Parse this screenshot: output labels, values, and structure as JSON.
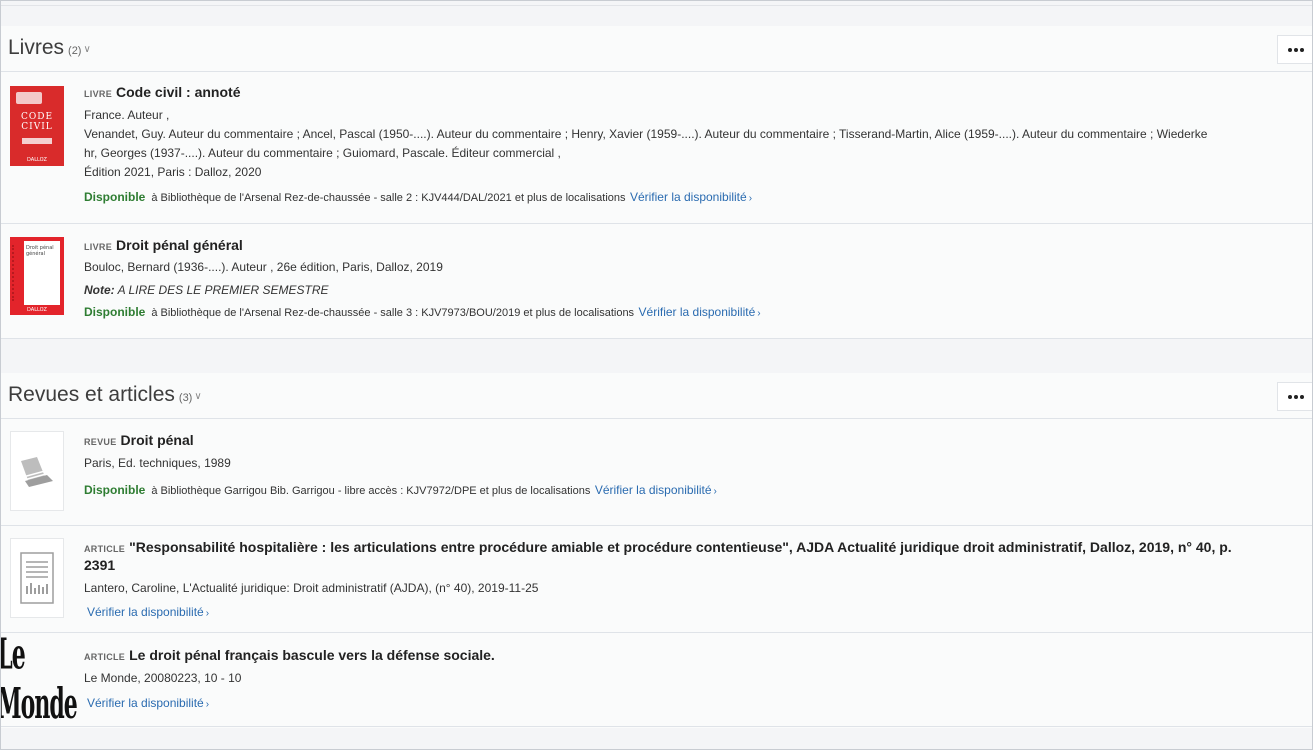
{
  "sections": [
    {
      "title": "Livres",
      "count": "(2)",
      "items": [
        {
          "type": "LIVRE",
          "title": "Code civil : annoté",
          "lines": [
            "France. Auteur ,",
            "Venandet, Guy. Auteur du commentaire ; Ancel, Pascal (1950-....). Auteur du commentaire ; Henry, Xavier (1959-....). Auteur du commentaire ; Tisserand-Martin, Alice (1959-....). Auteur du commentaire ; Wiederke",
            "hr, Georges (1937-....). Auteur du commentaire ; Guiomard, Pascale. Éditeur commercial ,",
            "Édition 2021, Paris : Dalloz, 2020"
          ],
          "availability": "Disponible",
          "location": "à Bibliothèque de l'Arsenal Rez-de-chaussée - salle 2 : KJV444/DAL/2021 et plus de localisations",
          "check_label": "Vérifier la disponibilité",
          "cover": {
            "title": "CODE CIVIL",
            "publisher": "DALLOZ",
            "color": "#d92b2b"
          }
        },
        {
          "type": "LIVRE",
          "title": "Droit pénal général",
          "lines": [
            "Bouloc, Bernard (1936-....). Auteur , 26e édition, Paris, Dalloz, 2019"
          ],
          "note_label": "Note:",
          "note": "A LIRE DES LE PREMIER SEMESTRE",
          "availability": "Disponible",
          "location": "à Bibliothèque de l'Arsenal Rez-de-chaussée - salle 3 : KJV7973/BOU/2019 et plus de localisations",
          "check_label": "Vérifier la disponibilité",
          "cover": {
            "title": "Droit pénal général",
            "publisher": "DALLOZ",
            "color": "#e3242b"
          }
        }
      ]
    },
    {
      "title": "Revues et articles",
      "count": "(3)",
      "items": [
        {
          "type": "REVUE",
          "title": "Droit pénal",
          "lines": [
            "Paris, Ed. techniques, 1989"
          ],
          "availability": "Disponible",
          "location": "à Bibliothèque Garrigou Bib. Garrigou - libre accès : KJV7972/DPE et plus de localisations",
          "check_label": "Vérifier la disponibilité",
          "cover": {
            "icon": "journal-icon"
          }
        },
        {
          "type": "ARTICLE",
          "title": "\"Responsabilité hospitalière : les articulations entre procédure amiable et procédure contentieuse\", AJDA Actualité juridique droit administratif, Dalloz, 2019, n° 40, p. 2391",
          "lines": [
            "Lantero, Caroline, L'Actualité juridique: Droit administratif (AJDA), (n° 40), 2019-11-25"
          ],
          "check_label": "Vérifier la disponibilité",
          "cover": {
            "icon": "article-icon"
          }
        },
        {
          "type": "ARTICLE",
          "title": "Le droit pénal français bascule vers la défense sociale.",
          "lines": [
            "Le Monde, 20080223, 10 - 10"
          ],
          "check_label": "Vérifier la disponibilité",
          "cover": {
            "logo": "Le Monde"
          }
        }
      ]
    }
  ],
  "icons": {
    "more": "more-options-icon",
    "chevron": "chevron-down-icon",
    "check_chevron": "chevron-right-icon"
  }
}
